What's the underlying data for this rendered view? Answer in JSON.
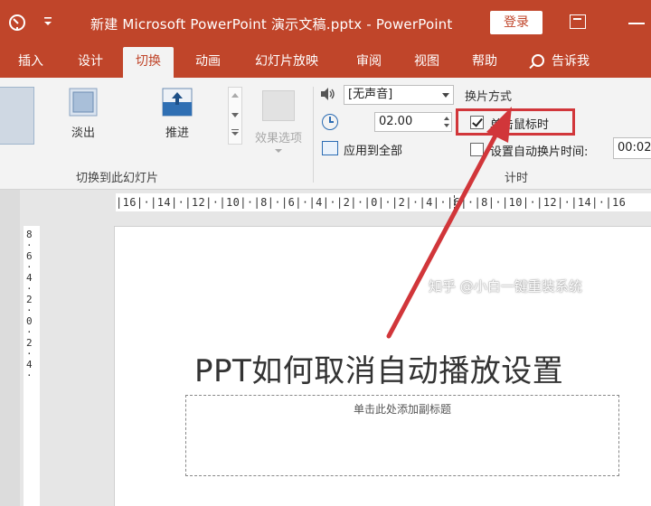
{
  "titlebar": {
    "title": "新建 Microsoft PowerPoint 演示文稿.pptx  -  PowerPoint",
    "login": "登录"
  },
  "tabs": [
    "插入",
    "设计",
    "切换",
    "动画",
    "幻灯片放映",
    "审阅",
    "视图",
    "帮助"
  ],
  "active_tab": "切换",
  "tell_me": "告诉我",
  "ribbon": {
    "gallery": {
      "fade_label": "淡出",
      "push_label": "推进",
      "group_label": "切换到此幻灯片"
    },
    "effect_options": "效果选项",
    "timing": {
      "sound_value": "[无声音]",
      "duration_value": "02.00",
      "apply_all": "应用到全部",
      "advance_header": "换片方式",
      "on_click_label": "单击鼠标时",
      "on_click_checked": true,
      "after_label": "设置自动换片时间:",
      "after_checked": false,
      "after_value": "00:02",
      "group_label_fragment": "计时"
    }
  },
  "ruler": {
    "horizontal": "|16|·|14|·|12|·|10|·|8|·|6|·|4|·|2|·|0|·|2|·|4|·|6|·|8|·|10|·|12|·|14|·|16",
    "vertical": "8·6·4·2·0·2·4·"
  },
  "slide": {
    "title": "PPT如何取消自动播放设置",
    "subtitle_placeholder": "单击此处添加副标题"
  },
  "watermark": "知乎 @小白一键重装系统",
  "colors": {
    "brand": "#c0452a",
    "highlight": "#d1363a",
    "arrow": "#d1363a"
  }
}
